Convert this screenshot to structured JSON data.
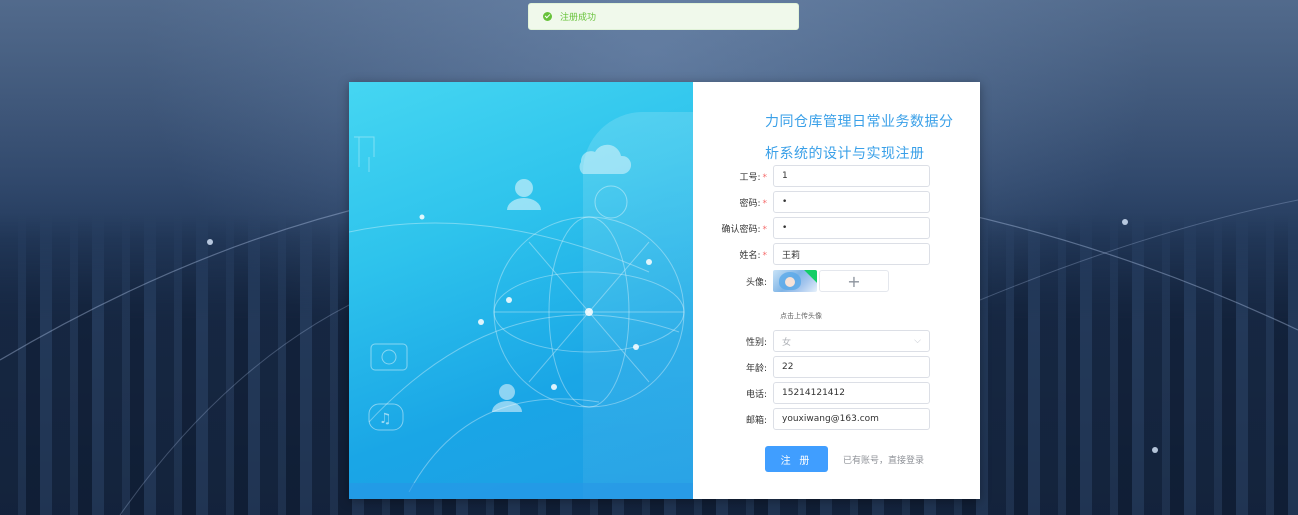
{
  "toast": {
    "message": "注册成功",
    "icon": "success-check-icon",
    "color": "#67c23a"
  },
  "title": "力同仓库管理日常业务数据分析系统的设计与实现注册",
  "fields": {
    "employee_no": {
      "label": "工号:",
      "value": "1",
      "required": true
    },
    "password": {
      "label": "密码:",
      "value": "•",
      "required": true
    },
    "confirm_password": {
      "label": "确认密码:",
      "value": "•",
      "required": true
    },
    "name": {
      "label": "姓名:",
      "value": "王莉",
      "required": true
    },
    "avatar": {
      "label": "头像:",
      "hint": "点击上传头像",
      "add": "+"
    },
    "gender": {
      "label": "性别:",
      "value": "女"
    },
    "age": {
      "label": "年龄:",
      "value": "22"
    },
    "phone": {
      "label": "电话:",
      "value": "15214121412"
    },
    "email": {
      "label": "邮箱:",
      "value": "youxiwang@163.com"
    }
  },
  "actions": {
    "register": "注 册",
    "login_link": "已有账号，直接登录"
  },
  "colors": {
    "primary": "#409eff",
    "title": "#3aa0e8",
    "required": "#f56c6c"
  }
}
